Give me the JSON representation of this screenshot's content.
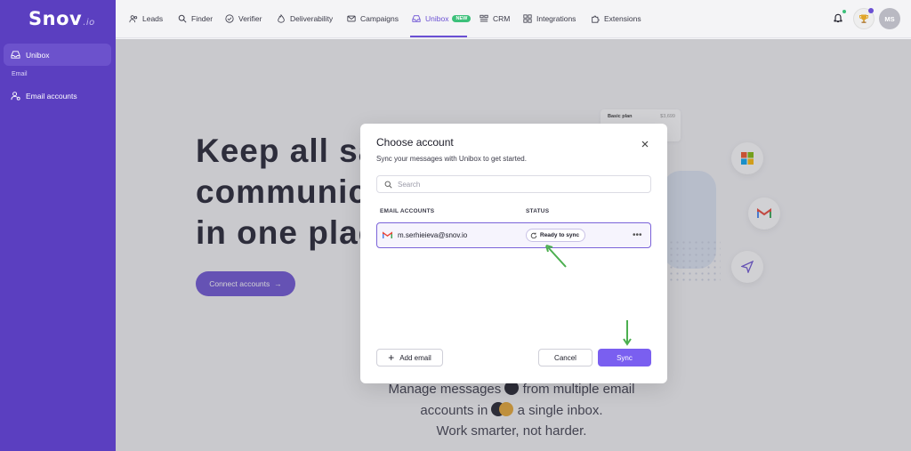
{
  "brand": {
    "name": "Snov",
    "suffix": "io"
  },
  "sidebar": {
    "items": [
      {
        "label": "Unibox",
        "icon": "inbox-icon",
        "active": true
      },
      {
        "label": "Email accounts",
        "icon": "user-settings-icon",
        "active": false
      }
    ],
    "section_label": "Email"
  },
  "nav": {
    "items": [
      {
        "label": "Leads",
        "icon": "users-icon"
      },
      {
        "label": "Finder",
        "icon": "search-icon"
      },
      {
        "label": "Verifier",
        "icon": "check-circle-icon"
      },
      {
        "label": "Deliverability",
        "icon": "flame-icon"
      },
      {
        "label": "Campaigns",
        "icon": "mail-icon"
      },
      {
        "label": "Unibox",
        "icon": "inbox-icon",
        "active": true,
        "badge": "NEW"
      },
      {
        "label": "CRM",
        "icon": "crm-icon"
      },
      {
        "label": "Integrations",
        "icon": "grid-icon"
      },
      {
        "label": "Extensions",
        "icon": "puzzle-icon"
      }
    ],
    "avatar_initials": "MS"
  },
  "hero": {
    "headline_lines": [
      "Keep all sa",
      "communic",
      "in one plac"
    ],
    "connect_label": "Connect accounts",
    "tagline_1": "Manage messages",
    "tagline_2": "from multiple email",
    "tagline_3": "accounts in",
    "tagline_4": "a single inbox.",
    "tagline_5": "Work smarter, not harder."
  },
  "illustration": {
    "plan_label": "Basic plan",
    "plan_price": "$3,699"
  },
  "modal": {
    "title": "Choose account",
    "subtitle": "Sync your messages with Unibox to get started.",
    "search_placeholder": "Search",
    "col_accounts": "EMAIL ACCOUNTS",
    "col_status": "STATUS",
    "account": {
      "email": "m.serhieieva@snov.io",
      "status": "Ready to sync",
      "more": "•••"
    },
    "add_email_label": "Add email",
    "cancel_label": "Cancel",
    "sync_label": "Sync"
  },
  "colors": {
    "sidebar": "#5b3fc0",
    "accent": "#6a4fd3",
    "sync_button": "#7a5ff0",
    "annotation_arrow": "#4caf50",
    "badge_new": "#3cc07a"
  }
}
